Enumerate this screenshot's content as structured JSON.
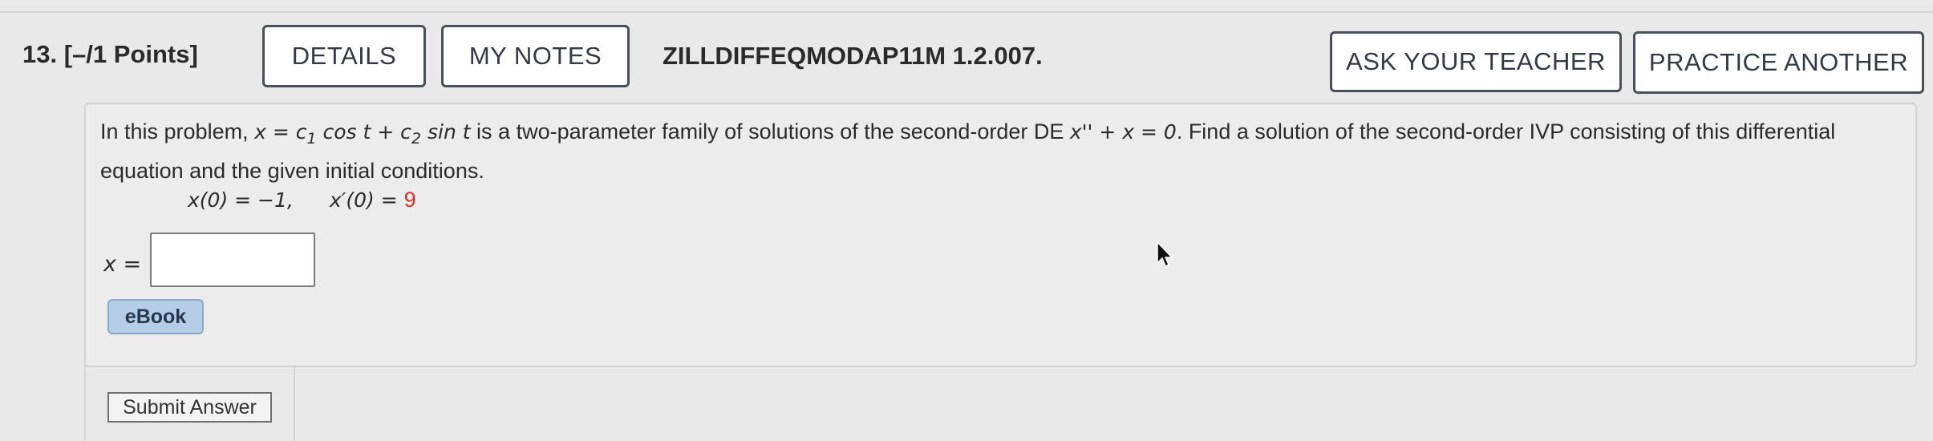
{
  "question": {
    "number": "13.",
    "points": "[–/1 Points]",
    "problem_id": "ZILLDIFFEQMODAP11M 1.2.007."
  },
  "toolbar": {
    "details_label": "DETAILS",
    "my_notes_label": "MY NOTES",
    "ask_teacher_label": "ASK YOUR TEACHER",
    "practice_label": "PRACTICE ANOTHER"
  },
  "problem": {
    "intro": "In this problem, ",
    "family": "x = c",
    "sub1": "1",
    "cos_part": " cos t + c",
    "sub2": "2",
    "sin_part": " sin t",
    "middle": " is a two-parameter family of solutions of the second-order DE ",
    "de": "x'' + x = 0",
    "rest": ". Find a solution of the second-order IVP consisting of this differential equation and the given initial conditions.",
    "ic_first": "x(0) = −1,",
    "ic_second_left": "x′(0) = ",
    "ic_second_value": "9"
  },
  "answer": {
    "label": "x =",
    "value": ""
  },
  "ebook_label": "eBook",
  "submit_label": "Submit Answer",
  "colors": {
    "button_border": "#4a5058",
    "ebook_bg": "#b5cde6",
    "highlight_red": "#d0342c",
    "panel_bg": "#ececec"
  }
}
